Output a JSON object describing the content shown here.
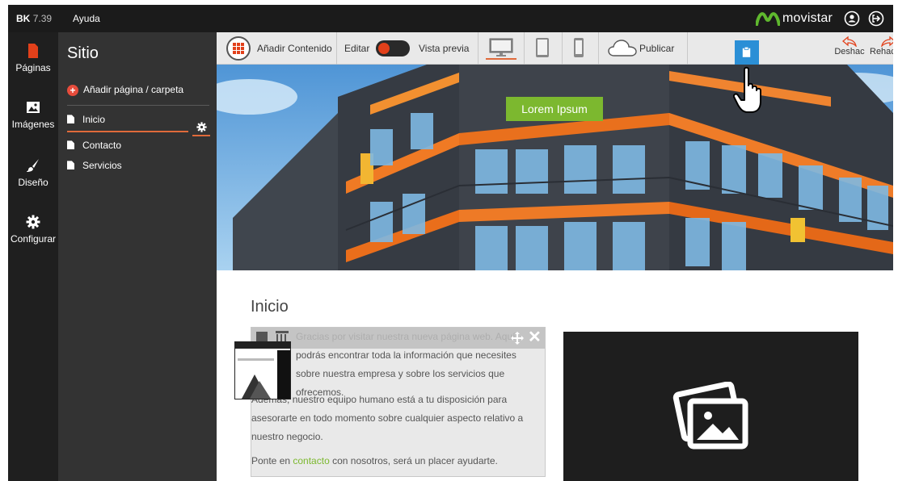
{
  "topbar": {
    "version_brand": "BK",
    "version_number": "7.39",
    "help_label": "Ayuda",
    "brand_name": "movistar"
  },
  "rail": {
    "items": [
      {
        "label": "Páginas",
        "icon": "page-icon"
      },
      {
        "label": "Imágenes",
        "icon": "image-icon"
      },
      {
        "label": "Diseño",
        "icon": "brush-icon"
      },
      {
        "label": "Configurar",
        "icon": "gear-icon"
      }
    ]
  },
  "site": {
    "title": "Sitio",
    "add_label": "Añadir página / carpeta",
    "pages": [
      {
        "label": "Inicio"
      },
      {
        "label": "Contacto"
      },
      {
        "label": "Servicios"
      }
    ]
  },
  "toolbar": {
    "add_content": "Añadir Contenido",
    "edit": "Editar",
    "preview": "Vista previa",
    "publish": "Publicar",
    "undo": "Deshac",
    "redo": "Rehace"
  },
  "hero": {
    "button_label": "Lorem Ipsum"
  },
  "content": {
    "title": "Inicio",
    "p1": "Gracias por visitar nuestra nueva página web. Aquí podrás encontrar toda la información que necesites sobre nuestra empresa y sobre los servicios que ofrecemos.",
    "p2_line1": "Además, nuestro equipo humano está a tu disposición para",
    "p2_line2": "asesorarte en todo momento sobre cualquier aspecto relativo a",
    "p2_line3": "nuestro negocio.",
    "p3_before": "Ponte en ",
    "p3_link": "contacto",
    "p3_after": " con nosotros, será un placer ayudarte."
  },
  "colors": {
    "accent": "#e2401a",
    "active_underline": "#e06a3a",
    "green": "#7cb82f",
    "blue": "#2b8fd6",
    "movistar_green": "#5fb82e"
  }
}
